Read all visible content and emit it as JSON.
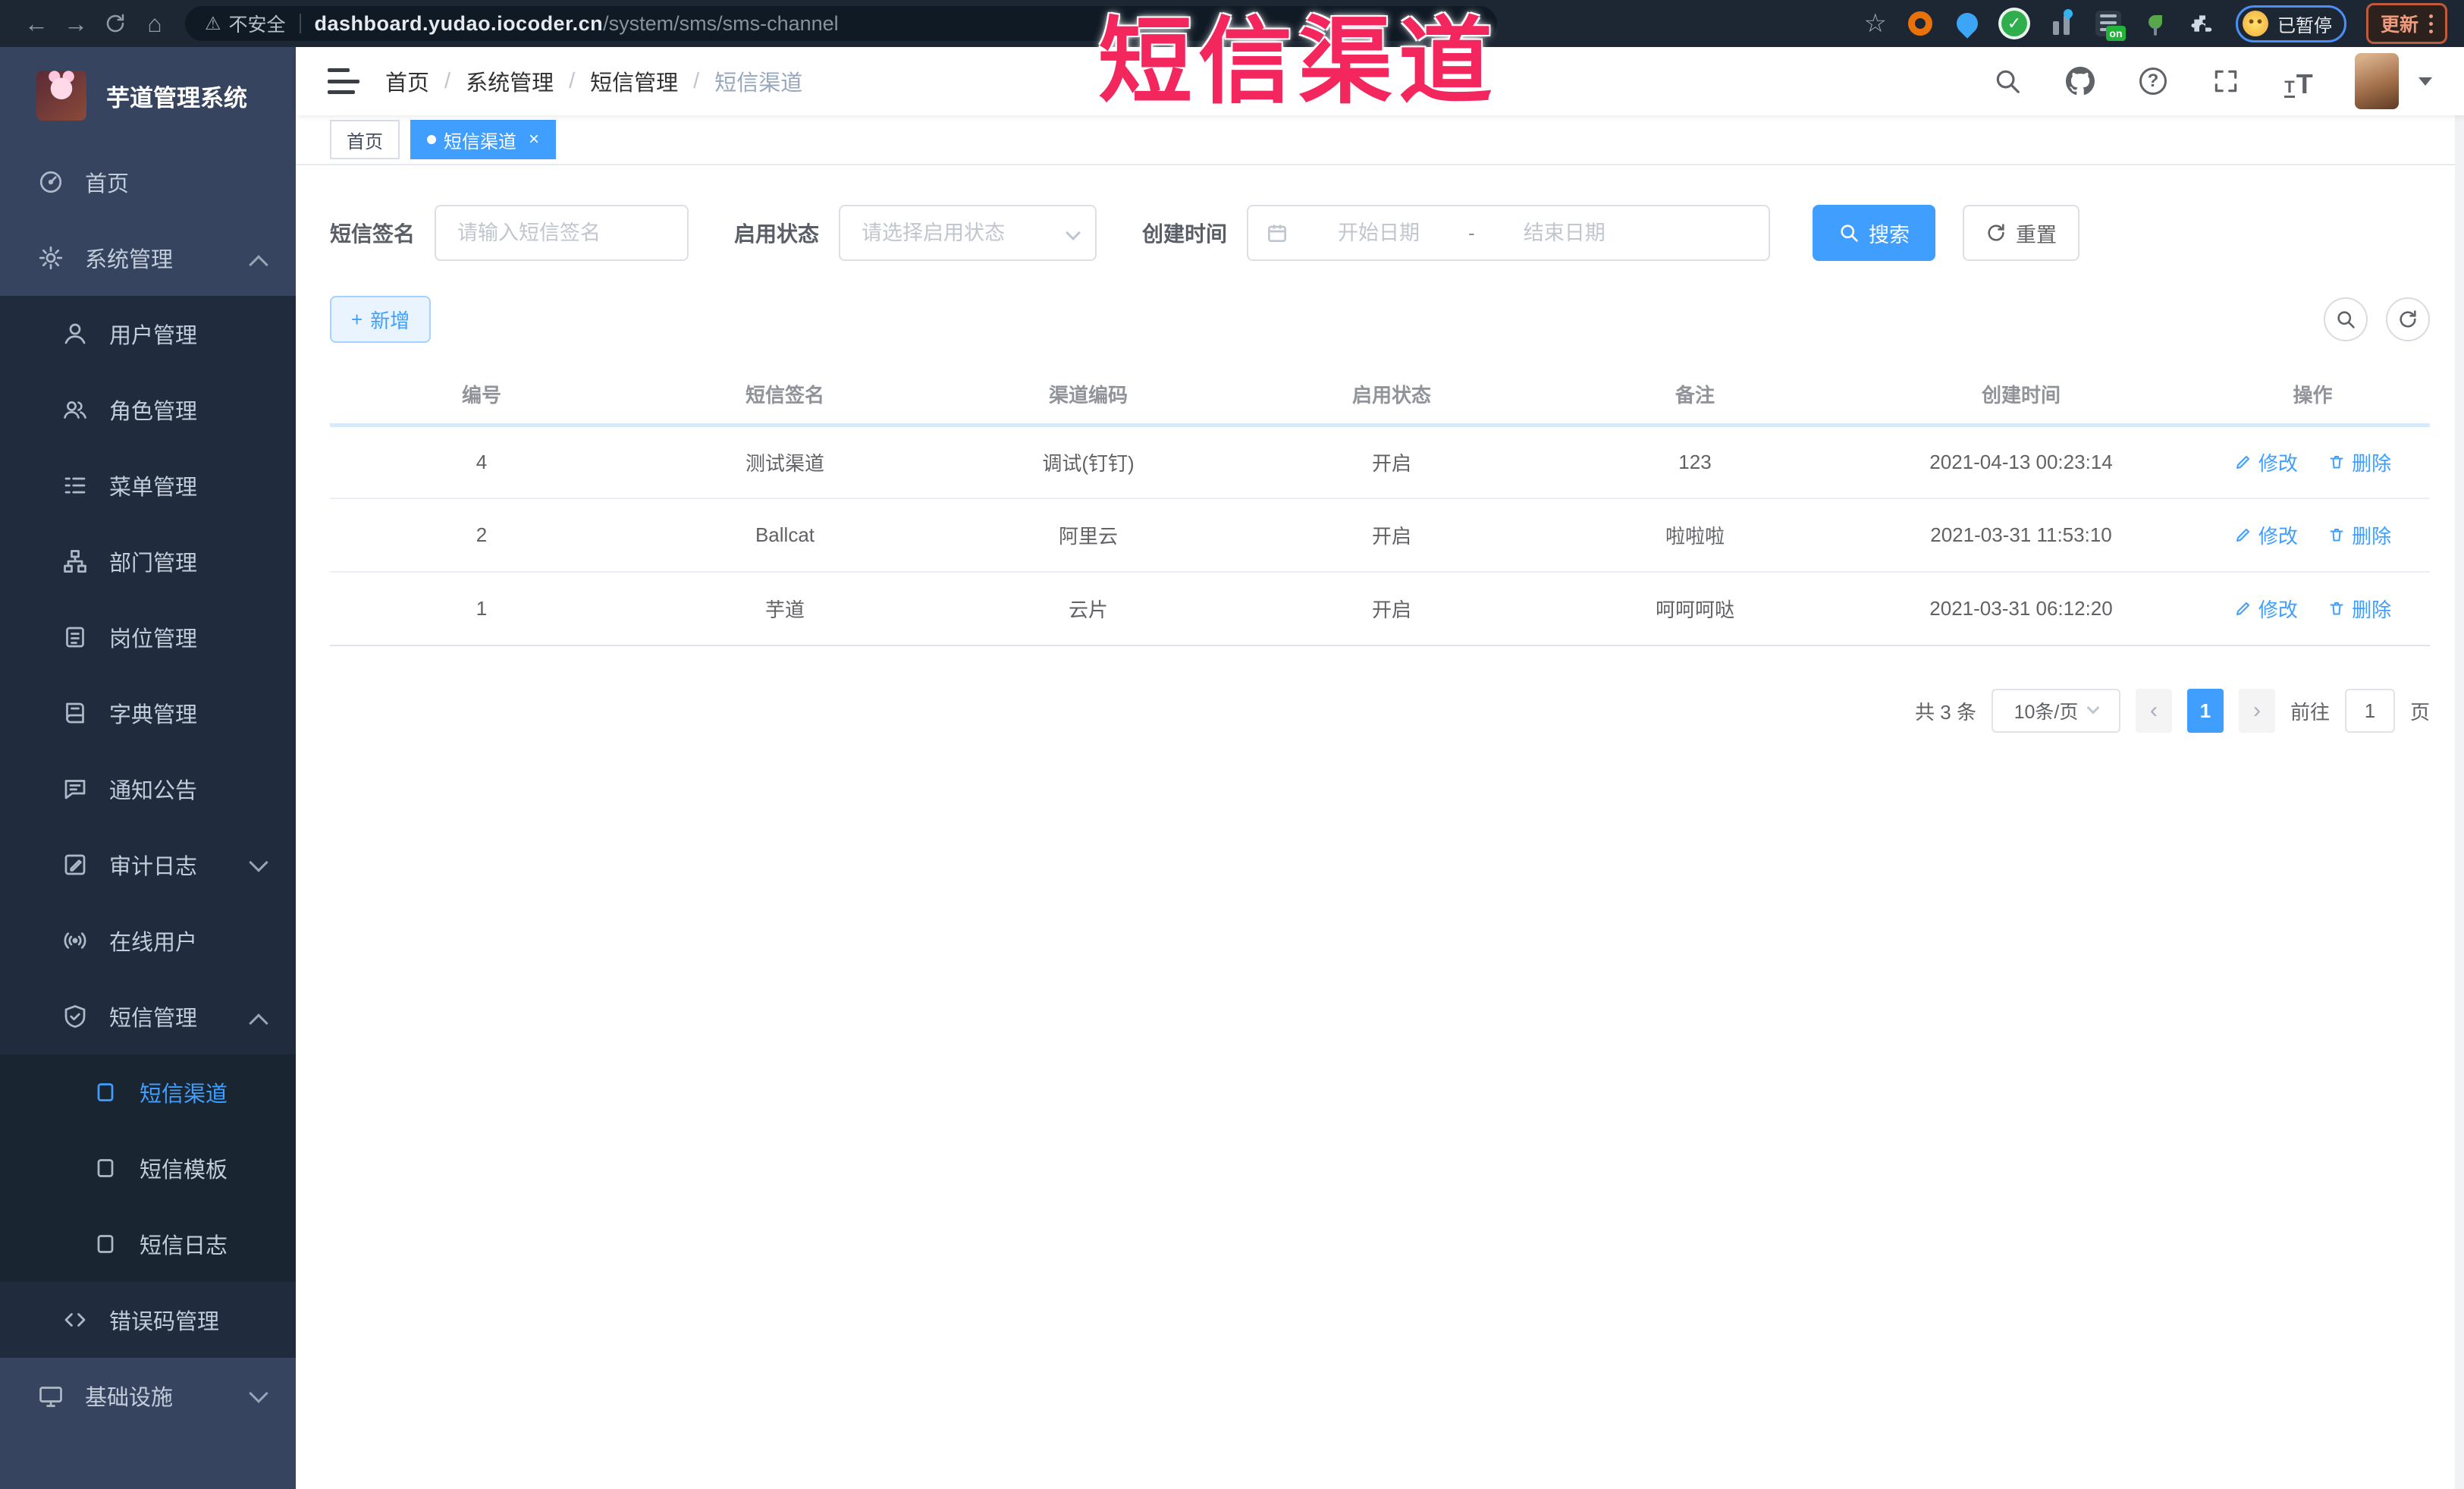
{
  "browser": {
    "security_label": "不安全",
    "url_host": "dashboard.yudao.iocoder.cn",
    "url_path": "/system/sms/sms-channel",
    "paused_badge": "已暂停",
    "update_button": "更新",
    "vpn_badge": "on"
  },
  "watermark": "短信渠道",
  "icons": {
    "back": "←",
    "forward": "→",
    "home": "⌂",
    "warning": "⚠",
    "star": "☆",
    "check": "✓",
    "close": "×",
    "plus": "+",
    "question": "?",
    "font_small": "T",
    "font_big": "T"
  },
  "sidebar": {
    "logo_title": "芋道管理系统",
    "items": [
      {
        "label": "首页"
      },
      {
        "label": "系统管理"
      },
      {
        "label": "用户管理"
      },
      {
        "label": "角色管理"
      },
      {
        "label": "菜单管理"
      },
      {
        "label": "部门管理"
      },
      {
        "label": "岗位管理"
      },
      {
        "label": "字典管理"
      },
      {
        "label": "通知公告"
      },
      {
        "label": "审计日志"
      },
      {
        "label": "在线用户"
      },
      {
        "label": "短信管理"
      },
      {
        "label": "短信渠道"
      },
      {
        "label": "短信模板"
      },
      {
        "label": "短信日志"
      },
      {
        "label": "错误码管理"
      },
      {
        "label": "基础设施"
      }
    ]
  },
  "header": {
    "breadcrumb": [
      "首页",
      "系统管理",
      "短信管理",
      "短信渠道"
    ],
    "separator": "/"
  },
  "tabs": [
    {
      "label": "首页"
    },
    {
      "label": "短信渠道"
    }
  ],
  "filters": {
    "sign_label": "短信签名",
    "sign_placeholder": "请输入短信签名",
    "status_label": "启用状态",
    "status_placeholder": "请选择启用状态",
    "date_label": "创建时间",
    "date_start_placeholder": "开始日期",
    "date_separator": "-",
    "date_end_placeholder": "结束日期",
    "search_button": "搜索",
    "reset_button": "重置"
  },
  "toolbar": {
    "add_button": "新增"
  },
  "table": {
    "headers": [
      "编号",
      "短信签名",
      "渠道编码",
      "启用状态",
      "备注",
      "创建时间",
      "操作"
    ],
    "edit_label": "修改",
    "delete_label": "删除",
    "rows": [
      {
        "id": "4",
        "sign": "测试渠道",
        "code": "调试(钉钉)",
        "status": "开启",
        "remark": "123",
        "created": "2021-04-13 00:23:14"
      },
      {
        "id": "2",
        "sign": "Ballcat",
        "code": "阿里云",
        "status": "开启",
        "remark": "啦啦啦",
        "created": "2021-03-31 11:53:10"
      },
      {
        "id": "1",
        "sign": "芋道",
        "code": "云片",
        "status": "开启",
        "remark": "呵呵呵哒",
        "created": "2021-03-31 06:12:20"
      }
    ]
  },
  "pagination": {
    "total": "共 3 条",
    "page_size": "10条/页",
    "current_page": "1",
    "goto_label": "前往",
    "goto_value": "1",
    "page_suffix": "页"
  },
  "colors": {
    "accent": "#409eff",
    "watermark_red": "#f3265d",
    "sidebar_bg": "#36445f",
    "submenu_bg": "#202c3e",
    "chrome_bg": "#1c2733"
  }
}
